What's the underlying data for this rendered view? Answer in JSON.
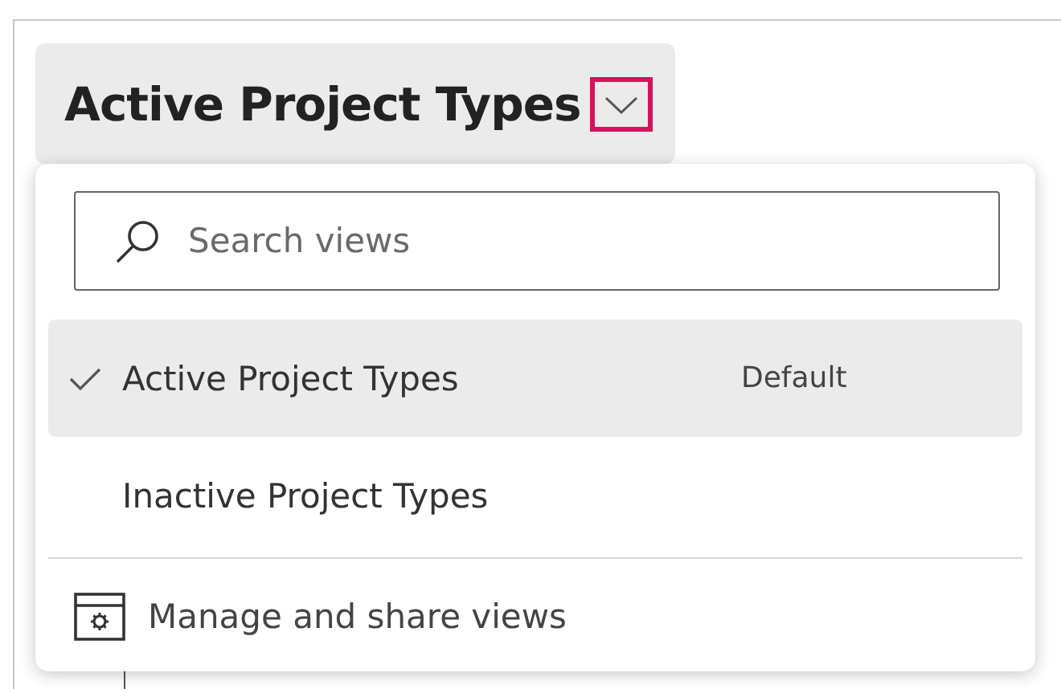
{
  "view_selector": {
    "title": "Active Project Types"
  },
  "menu": {
    "search": {
      "placeholder": "Search views"
    },
    "views": [
      {
        "label": "Active Project Types",
        "badge": "Default",
        "selected": true
      },
      {
        "label": "Inactive Project Types",
        "selected": false
      }
    ],
    "footer": {
      "label": "Manage and share views"
    }
  }
}
